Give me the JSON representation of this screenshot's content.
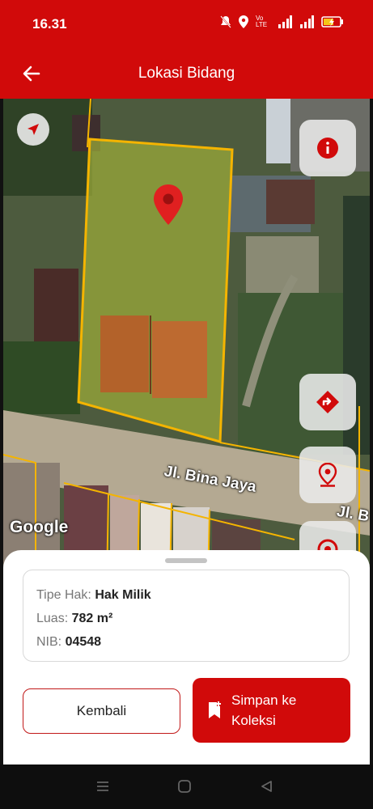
{
  "status_bar": {
    "time": "16.31",
    "network_label": "Vo LTE",
    "signal_label": "4G"
  },
  "header": {
    "title": "Lokasi Bidang"
  },
  "map": {
    "street_label": "Jl. Bina Jaya",
    "street_label_2": "Jl. B",
    "attribution": "Google",
    "parcel_color": "#f4b400",
    "pin_color": "#e02020"
  },
  "parcel_info": {
    "rights_type_label": "Tipe Hak:",
    "rights_type_value": "Hak Milik",
    "area_label": "Luas:",
    "area_value": "782 m²",
    "nib_label": "NIB:",
    "nib_value": "04548"
  },
  "actions": {
    "back_label": "Kembali",
    "save_label": "Simpan ke Koleksi"
  },
  "colors": {
    "accent": "#d10a0a"
  }
}
